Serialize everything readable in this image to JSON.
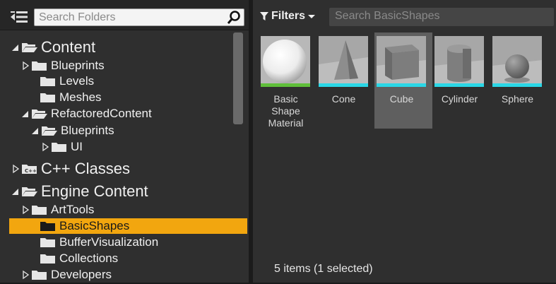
{
  "folders_panel": {
    "search_placeholder": "Search Folders",
    "tree": [
      {
        "label": "Content",
        "expanded": true,
        "icon": "folder-open-icon"
      },
      {
        "label": "Blueprints",
        "expanded": false,
        "icon": "folder-icon"
      },
      {
        "label": "Levels",
        "icon": "folder-icon"
      },
      {
        "label": "Meshes",
        "icon": "folder-icon"
      },
      {
        "label": "RefactoredContent",
        "expanded": true,
        "icon": "folder-open-icon"
      },
      {
        "label": "Blueprints",
        "expanded": true,
        "icon": "folder-open-icon"
      },
      {
        "label": "UI",
        "expanded": false,
        "icon": "folder-icon"
      },
      {
        "label": "C++ Classes",
        "expanded": false,
        "icon": "cpp-folder-icon"
      },
      {
        "label": "Engine Content",
        "expanded": true,
        "icon": "folder-open-icon"
      },
      {
        "label": "ArtTools",
        "expanded": false,
        "icon": "folder-icon"
      },
      {
        "label": "BasicShapes",
        "selected": true,
        "icon": "folder-icon"
      },
      {
        "label": "BufferVisualization",
        "icon": "folder-icon"
      },
      {
        "label": "Collections",
        "icon": "folder-icon"
      },
      {
        "label": "Developers",
        "expanded": false,
        "icon": "folder-icon"
      }
    ]
  },
  "assets_panel": {
    "filters_label": "Filters",
    "search_placeholder": "Search BasicShapes",
    "assets": [
      {
        "name": "Basic Shape Material",
        "strip_color": "#5fbf3a",
        "icon": "sphere-material-icon"
      },
      {
        "name": "Cone",
        "strip_color": "#2ad7e6",
        "icon": "cone-icon"
      },
      {
        "name": "Cube",
        "strip_color": "#2ad7e6",
        "icon": "cube-icon",
        "selected": true
      },
      {
        "name": "Cylinder",
        "strip_color": "#2ad7e6",
        "icon": "cylinder-icon"
      },
      {
        "name": "Sphere",
        "strip_color": "#2ad7e6",
        "icon": "sphere-icon"
      }
    ],
    "status": "5 items (1 selected)"
  },
  "colors": {
    "selection": "#f2a60f",
    "panel": "#2f2f2f"
  }
}
